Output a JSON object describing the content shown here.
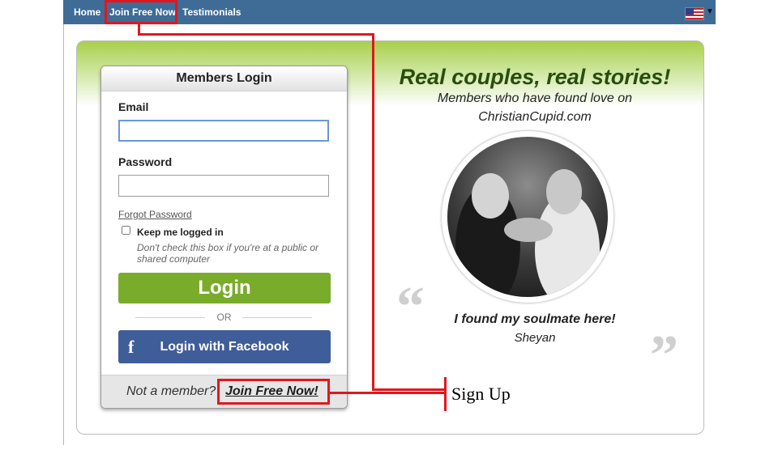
{
  "nav": {
    "items": [
      "Home",
      "Join Free Now",
      "Testimonials"
    ],
    "flag_icon": "us-flag-icon",
    "caret_icon": "caret-down-icon"
  },
  "login": {
    "title": "Members Login",
    "email_label": "Email",
    "email_value": "",
    "password_label": "Password",
    "password_value": "",
    "forgot": "Forgot Password",
    "keep_label": "Keep me logged in",
    "keep_hint": "Don't check this box if you're at a public or shared computer",
    "keep_checked": false,
    "login_button": "Login",
    "or": "OR",
    "facebook_icon": "f",
    "facebook_button": "Login with Facebook",
    "not_member": "Not a member?",
    "join_link": "Join Free Now!"
  },
  "stories": {
    "headline": "Real couples, real stories!",
    "subline_1": "Members who have found love on",
    "subline_2": "ChristianCupid.com",
    "quote_open": "“",
    "quote_close": "”",
    "testimonial": "I found my soulmate here!",
    "author": "Sheyan"
  },
  "annotation": {
    "label": "Sign Up",
    "color": "#e2161e"
  },
  "colors": {
    "nav_bg": "#3f6c96",
    "login_green": "#7aac2c",
    "facebook_blue": "#3f5d99",
    "headline_green": "#294d0c"
  }
}
